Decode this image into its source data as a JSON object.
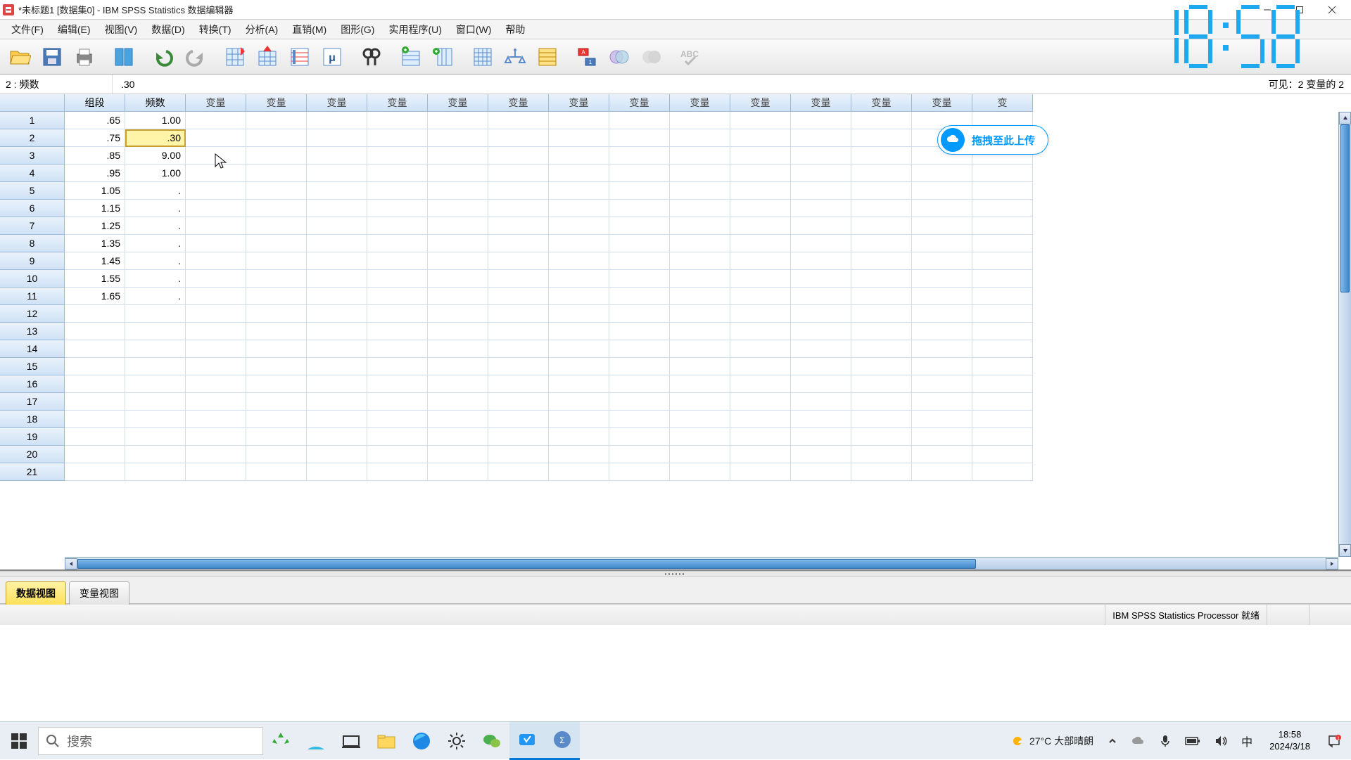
{
  "title": "*未标题1 [数据集0] - IBM SPSS Statistics 数据编辑器",
  "menu": [
    "文件(F)",
    "编辑(E)",
    "视图(V)",
    "数据(D)",
    "转换(T)",
    "分析(A)",
    "直销(M)",
    "图形(G)",
    "实用程序(U)",
    "窗口(W)",
    "帮助"
  ],
  "cellref": "2 : 频数",
  "cellval": ".30",
  "visible": "可见：2 变量的 2",
  "columns": [
    "组段",
    "频数",
    "变量",
    "变量",
    "变量",
    "变量",
    "变量",
    "变量",
    "变量",
    "变量",
    "变量",
    "变量",
    "变量",
    "变量",
    "变量",
    "变"
  ],
  "rows": [
    {
      "n": 1,
      "c": [
        ".65",
        "1.00"
      ]
    },
    {
      "n": 2,
      "c": [
        ".75",
        ".30"
      ]
    },
    {
      "n": 3,
      "c": [
        ".85",
        "9.00"
      ]
    },
    {
      "n": 4,
      "c": [
        ".95",
        "1.00"
      ]
    },
    {
      "n": 5,
      "c": [
        "1.05",
        "."
      ]
    },
    {
      "n": 6,
      "c": [
        "1.15",
        "."
      ]
    },
    {
      "n": 7,
      "c": [
        "1.25",
        "."
      ]
    },
    {
      "n": 8,
      "c": [
        "1.35",
        "."
      ]
    },
    {
      "n": 9,
      "c": [
        "1.45",
        "."
      ]
    },
    {
      "n": 10,
      "c": [
        "1.55",
        "."
      ]
    },
    {
      "n": 11,
      "c": [
        "1.65",
        "."
      ]
    },
    {
      "n": 12,
      "c": [
        "",
        ""
      ]
    },
    {
      "n": 13,
      "c": [
        "",
        ""
      ]
    },
    {
      "n": 14,
      "c": [
        "",
        ""
      ]
    },
    {
      "n": 15,
      "c": [
        "",
        ""
      ]
    },
    {
      "n": 16,
      "c": [
        "",
        ""
      ]
    },
    {
      "n": 17,
      "c": [
        "",
        ""
      ]
    },
    {
      "n": 18,
      "c": [
        "",
        ""
      ]
    },
    {
      "n": 19,
      "c": [
        "",
        ""
      ]
    },
    {
      "n": 20,
      "c": [
        "",
        ""
      ]
    },
    {
      "n": 21,
      "c": [
        "",
        ""
      ]
    }
  ],
  "selected": {
    "row": 2,
    "col": 2
  },
  "tabs": {
    "data": "数据视图",
    "variable": "变量视图"
  },
  "status": "IBM SPSS Statistics Processor 就绪",
  "upload": "拖拽至此上传",
  "taskbar": {
    "search_placeholder": "搜索",
    "weather": "27°C 大部晴朗",
    "ime": "中",
    "time": "18:58",
    "date": "2024/3/18"
  },
  "clock": "18:58"
}
